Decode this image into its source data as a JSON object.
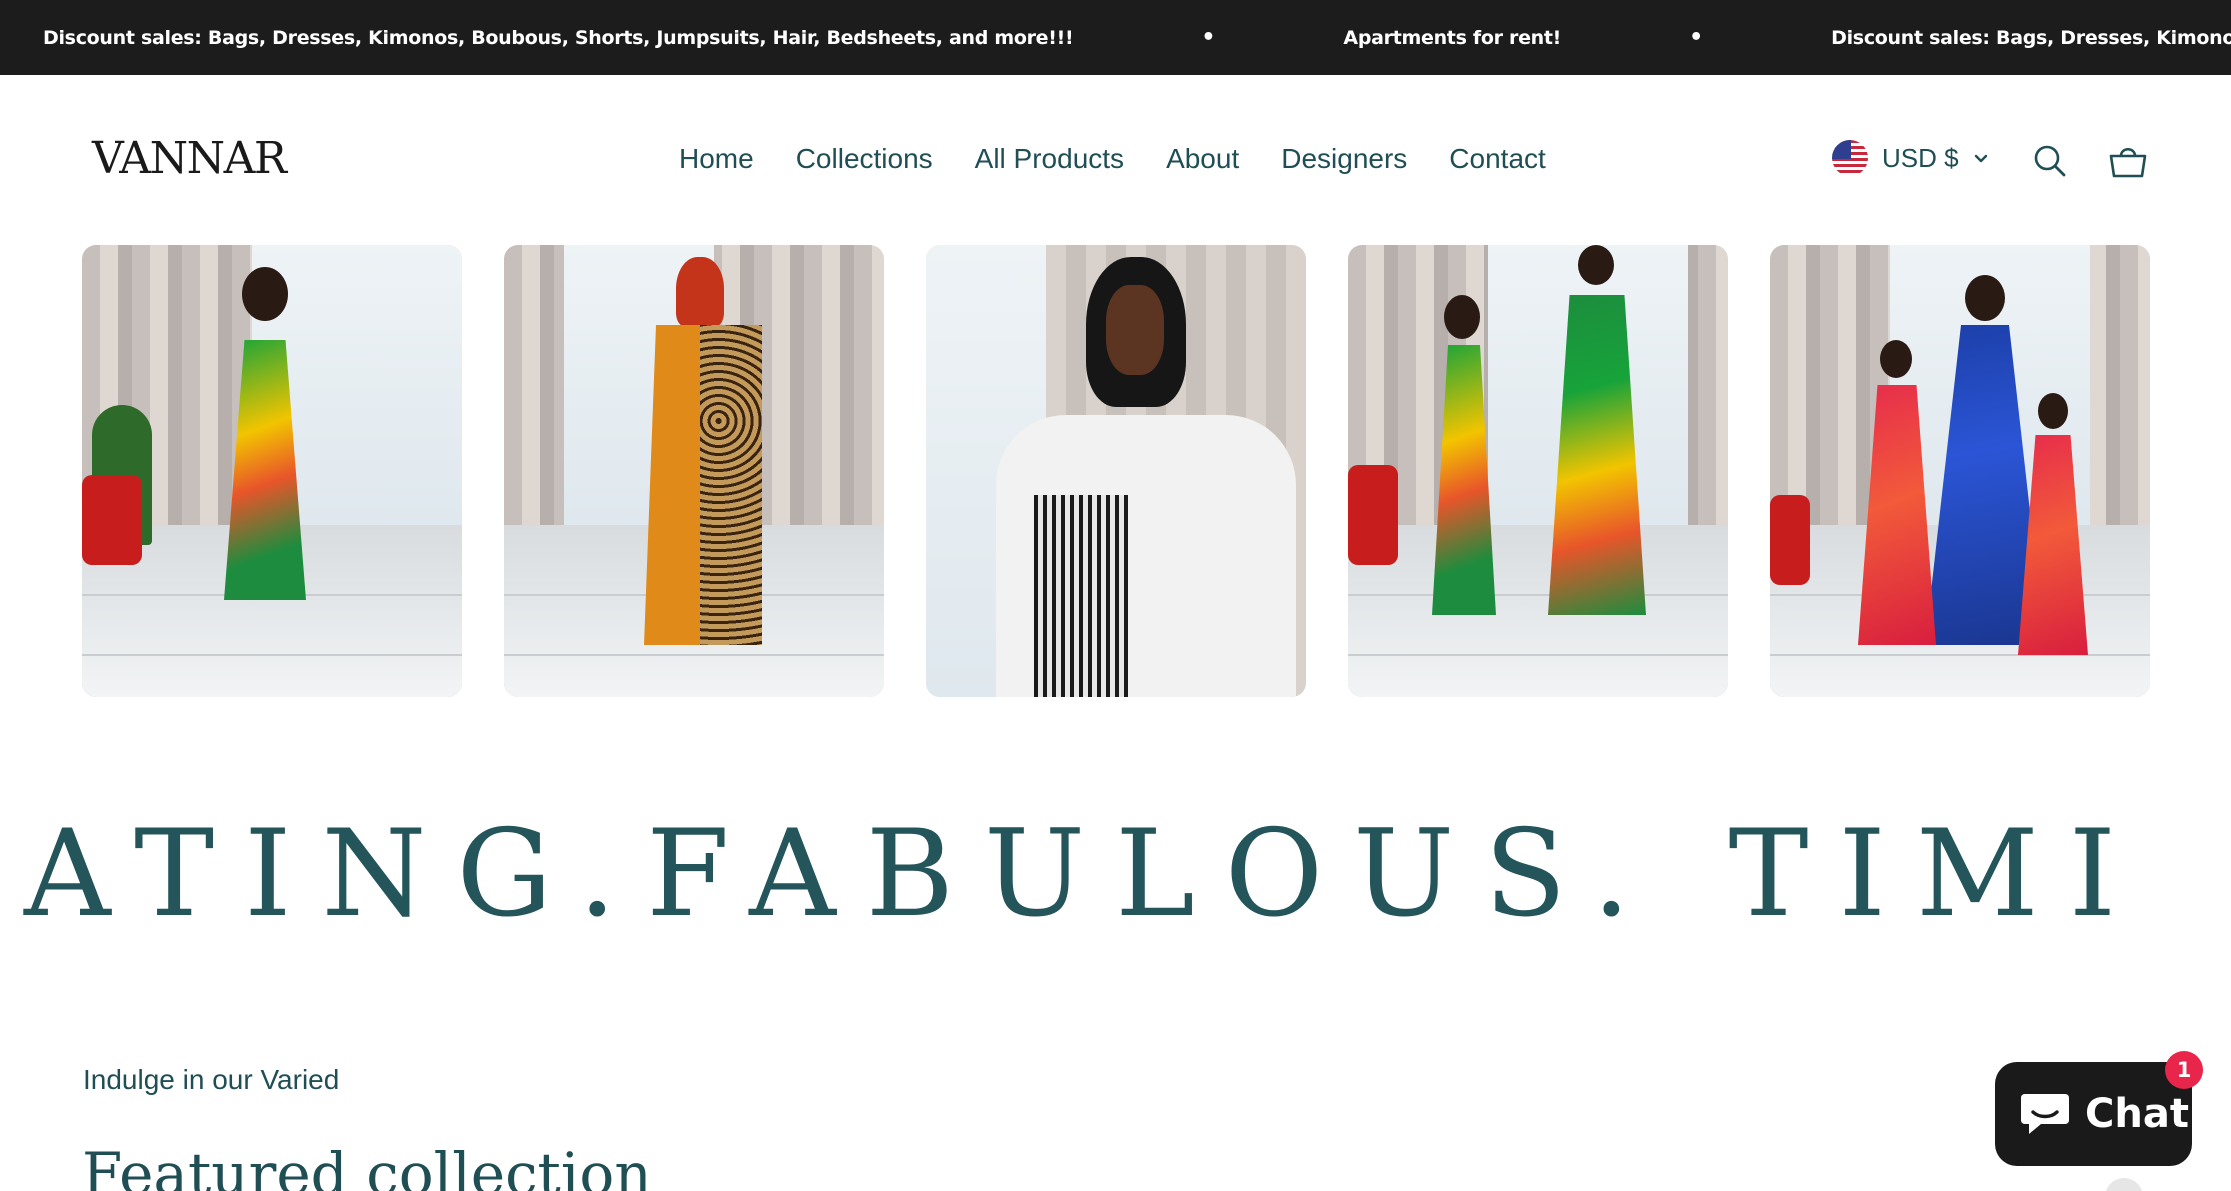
{
  "announcement": {
    "items": [
      "Discount sales: Bags, Dresses, Kimonos, Boubous, Shorts, Jumpsuits, Hair, Bedsheets, and more!!!",
      "Apartments for rent!",
      "Discount sales: Bags, Dresses, Kimonos, Boubous, Shorts, Jumpsuits, Hair, Bedsheets, and more!!!"
    ],
    "separator": "•"
  },
  "header": {
    "logo": "VANNAR",
    "nav": [
      "Home",
      "Collections",
      "All Products",
      "About",
      "Designers",
      "Contact"
    ],
    "currency": "USD $",
    "icons": [
      "us-flag-icon",
      "chevron-down-icon",
      "search-icon",
      "cart-basket-icon"
    ]
  },
  "gallery": {
    "images": [
      "girl in green tiered print dress",
      "woman in orange and leopard print kimono",
      "woman in white dress with black print panel",
      "two girls in matching green print dresses",
      "woman and two girls in red and blue print dresses"
    ]
  },
  "marquee": {
    "text": "ATING.FABULOUS.   TIMI"
  },
  "featured": {
    "subheading": "Indulge in our Varied",
    "heading": "Featured collection"
  },
  "chat": {
    "label": "Chat",
    "badge": "1",
    "icon": "chat-bubble-icon"
  },
  "colors": {
    "announcement_bg": "#1c1c1c",
    "text_primary": "#1f4e54",
    "chat_bg": "#1a1a1a",
    "badge": "#e8254a"
  }
}
